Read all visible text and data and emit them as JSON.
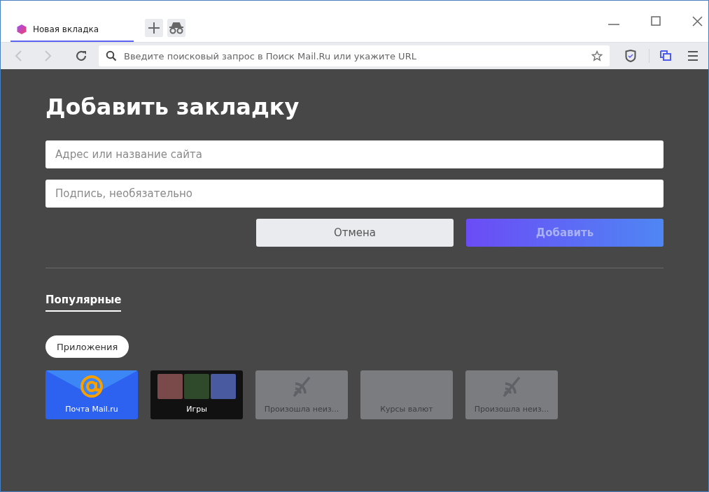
{
  "browser_tab": {
    "title": "Новая вкладка",
    "selected": true
  },
  "address_bar": {
    "placeholder": "Введите поисковый запрос в Поиск Mail.Ru или укажите URL"
  },
  "heading": "Добавить закладку",
  "fields": [
    {
      "placeholder": "Адрес или название сайта"
    },
    {
      "placeholder": "Подпись, необязательно"
    }
  ],
  "buttons": [
    {
      "label": "Отмена",
      "kind": "secondary"
    },
    {
      "label": "Добавить",
      "kind": "primary"
    }
  ],
  "section_tabs": [
    {
      "label": "Популярные",
      "selected": true
    }
  ],
  "filters": [
    {
      "label": "Приложения",
      "selected": true
    }
  ],
  "tiles": [
    {
      "kind": "mail",
      "label": "Почта Mail.ru"
    },
    {
      "kind": "games",
      "label": "Игры"
    },
    {
      "kind": "error",
      "label": "Произошла неиз..."
    },
    {
      "kind": "plain",
      "label": "Курсы валют"
    },
    {
      "kind": "error",
      "label": "Произошла неиз..."
    }
  ]
}
